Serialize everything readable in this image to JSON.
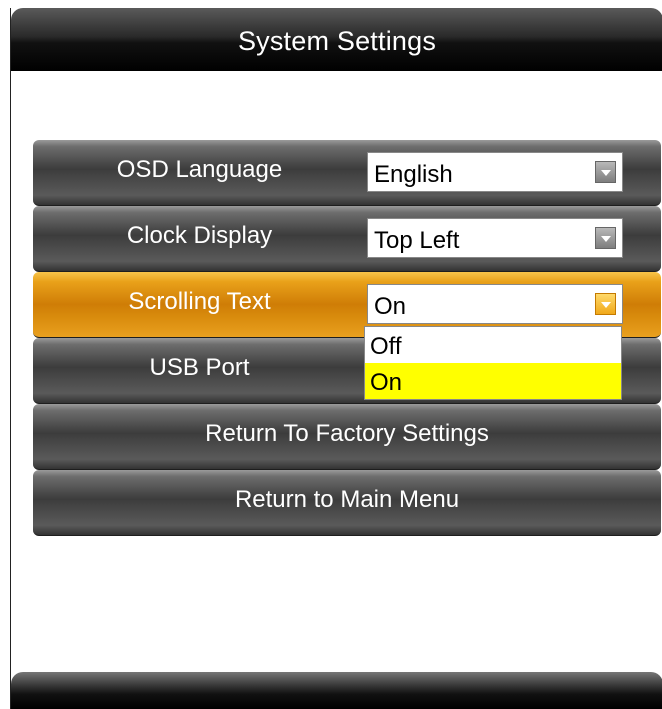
{
  "header": {
    "title": "System Settings"
  },
  "menu": {
    "rows": [
      {
        "label": "OSD Language",
        "value": "English"
      },
      {
        "label": "Clock Display",
        "value": "Top Left"
      },
      {
        "label": "Scrolling Text",
        "value": "On"
      },
      {
        "label": "USB Port"
      },
      {
        "label": "Return To Factory Settings"
      },
      {
        "label": "Return to Main Menu"
      }
    ]
  },
  "dropdown": {
    "options": [
      "Off",
      "On"
    ],
    "selected": "On"
  },
  "colors": {
    "active_row": "#e9a11a",
    "selected_option": "#ffff00",
    "header": "#000000"
  },
  "icons": {
    "dropdown_arrow": "chevron-down-icon"
  }
}
